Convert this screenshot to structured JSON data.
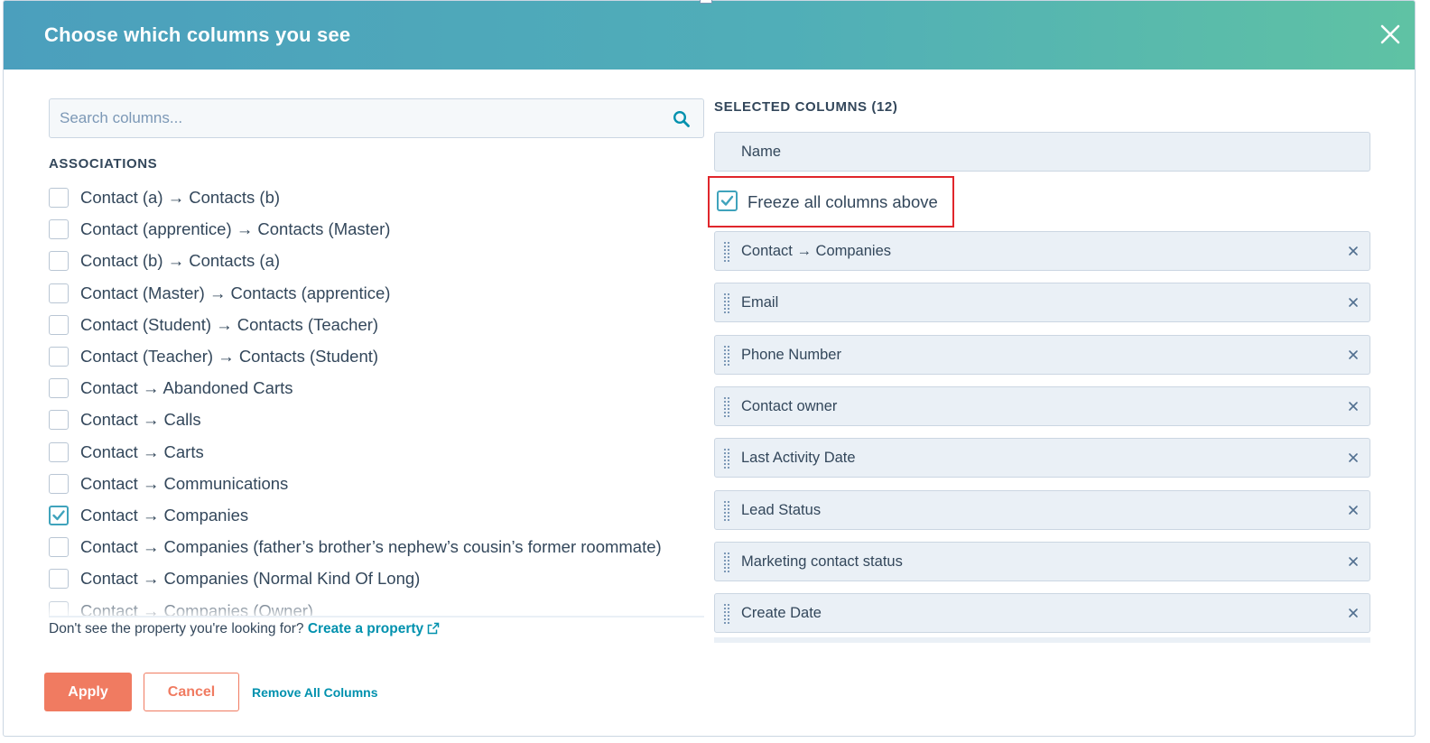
{
  "modal": {
    "title": "Choose which columns you see"
  },
  "search": {
    "placeholder": "Search columns..."
  },
  "associations": {
    "heading": "ASSOCIATIONS",
    "items": [
      {
        "label": "Contact (a) → Contacts (b)",
        "checked": false
      },
      {
        "label": "Contact (apprentice) → Contacts (Master)",
        "checked": false
      },
      {
        "label": "Contact (b) → Contacts (a)",
        "checked": false
      },
      {
        "label": "Contact (Master) → Contacts (apprentice)",
        "checked": false
      },
      {
        "label": "Contact (Student) → Contacts (Teacher)",
        "checked": false
      },
      {
        "label": "Contact (Teacher) → Contacts (Student)",
        "checked": false
      },
      {
        "label": "Contact → Abandoned Carts",
        "checked": false
      },
      {
        "label": "Contact → Calls",
        "checked": false
      },
      {
        "label": "Contact → Carts",
        "checked": false
      },
      {
        "label": "Contact → Communications",
        "checked": false
      },
      {
        "label": "Contact → Companies",
        "checked": true
      },
      {
        "label": "Contact → Companies (father’s brother’s nephew’s cousin’s former roommate)",
        "checked": false
      },
      {
        "label": "Contact → Companies (Normal Kind Of Long)",
        "checked": false
      },
      {
        "label": "Contact → Companies (Owner)",
        "checked": false
      }
    ]
  },
  "help": {
    "text": "Don't see the property you're looking for?",
    "link": "Create a property"
  },
  "selected": {
    "heading": "SELECTED COLUMNS (12)",
    "fixed_column": "Name",
    "freeze_label": "Freeze all columns above",
    "freeze_checked": true,
    "columns": [
      "Contact → Companies",
      "Email",
      "Phone Number",
      "Contact owner",
      "Last Activity Date",
      "Lead Status",
      "Marketing contact status",
      "Create Date"
    ]
  },
  "footer": {
    "apply": "Apply",
    "cancel": "Cancel",
    "remove_all": "Remove All Columns"
  },
  "colors": {
    "header_gradient_start": "#4b9fbd",
    "header_gradient_end": "#5fc2a4",
    "primary_button": "#f07b61",
    "link": "#0091ae",
    "checkbox_checked": "#3fa3bc",
    "highlight_box": "#e0262b"
  }
}
